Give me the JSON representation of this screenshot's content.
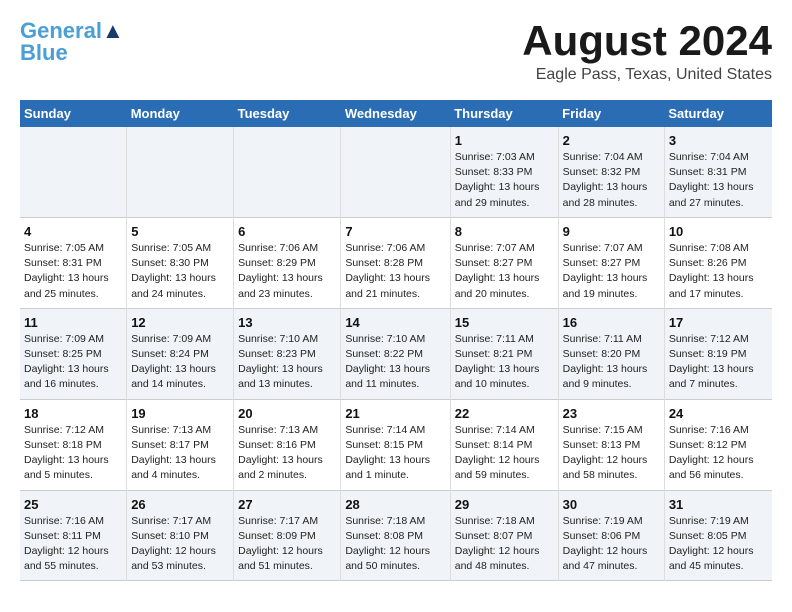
{
  "header": {
    "logo_line1": "General",
    "logo_line2": "Blue",
    "title": "August 2024",
    "subtitle": "Eagle Pass, Texas, United States"
  },
  "weekdays": [
    "Sunday",
    "Monday",
    "Tuesday",
    "Wednesday",
    "Thursday",
    "Friday",
    "Saturday"
  ],
  "weeks": [
    [
      {
        "day": "",
        "info": ""
      },
      {
        "day": "",
        "info": ""
      },
      {
        "day": "",
        "info": ""
      },
      {
        "day": "",
        "info": ""
      },
      {
        "day": "1",
        "info": "Sunrise: 7:03 AM\nSunset: 8:33 PM\nDaylight: 13 hours and 29 minutes."
      },
      {
        "day": "2",
        "info": "Sunrise: 7:04 AM\nSunset: 8:32 PM\nDaylight: 13 hours and 28 minutes."
      },
      {
        "day": "3",
        "info": "Sunrise: 7:04 AM\nSunset: 8:31 PM\nDaylight: 13 hours and 27 minutes."
      }
    ],
    [
      {
        "day": "4",
        "info": "Sunrise: 7:05 AM\nSunset: 8:31 PM\nDaylight: 13 hours and 25 minutes."
      },
      {
        "day": "5",
        "info": "Sunrise: 7:05 AM\nSunset: 8:30 PM\nDaylight: 13 hours and 24 minutes."
      },
      {
        "day": "6",
        "info": "Sunrise: 7:06 AM\nSunset: 8:29 PM\nDaylight: 13 hours and 23 minutes."
      },
      {
        "day": "7",
        "info": "Sunrise: 7:06 AM\nSunset: 8:28 PM\nDaylight: 13 hours and 21 minutes."
      },
      {
        "day": "8",
        "info": "Sunrise: 7:07 AM\nSunset: 8:27 PM\nDaylight: 13 hours and 20 minutes."
      },
      {
        "day": "9",
        "info": "Sunrise: 7:07 AM\nSunset: 8:27 PM\nDaylight: 13 hours and 19 minutes."
      },
      {
        "day": "10",
        "info": "Sunrise: 7:08 AM\nSunset: 8:26 PM\nDaylight: 13 hours and 17 minutes."
      }
    ],
    [
      {
        "day": "11",
        "info": "Sunrise: 7:09 AM\nSunset: 8:25 PM\nDaylight: 13 hours and 16 minutes."
      },
      {
        "day": "12",
        "info": "Sunrise: 7:09 AM\nSunset: 8:24 PM\nDaylight: 13 hours and 14 minutes."
      },
      {
        "day": "13",
        "info": "Sunrise: 7:10 AM\nSunset: 8:23 PM\nDaylight: 13 hours and 13 minutes."
      },
      {
        "day": "14",
        "info": "Sunrise: 7:10 AM\nSunset: 8:22 PM\nDaylight: 13 hours and 11 minutes."
      },
      {
        "day": "15",
        "info": "Sunrise: 7:11 AM\nSunset: 8:21 PM\nDaylight: 13 hours and 10 minutes."
      },
      {
        "day": "16",
        "info": "Sunrise: 7:11 AM\nSunset: 8:20 PM\nDaylight: 13 hours and 9 minutes."
      },
      {
        "day": "17",
        "info": "Sunrise: 7:12 AM\nSunset: 8:19 PM\nDaylight: 13 hours and 7 minutes."
      }
    ],
    [
      {
        "day": "18",
        "info": "Sunrise: 7:12 AM\nSunset: 8:18 PM\nDaylight: 13 hours and 5 minutes."
      },
      {
        "day": "19",
        "info": "Sunrise: 7:13 AM\nSunset: 8:17 PM\nDaylight: 13 hours and 4 minutes."
      },
      {
        "day": "20",
        "info": "Sunrise: 7:13 AM\nSunset: 8:16 PM\nDaylight: 13 hours and 2 minutes."
      },
      {
        "day": "21",
        "info": "Sunrise: 7:14 AM\nSunset: 8:15 PM\nDaylight: 13 hours and 1 minute."
      },
      {
        "day": "22",
        "info": "Sunrise: 7:14 AM\nSunset: 8:14 PM\nDaylight: 12 hours and 59 minutes."
      },
      {
        "day": "23",
        "info": "Sunrise: 7:15 AM\nSunset: 8:13 PM\nDaylight: 12 hours and 58 minutes."
      },
      {
        "day": "24",
        "info": "Sunrise: 7:16 AM\nSunset: 8:12 PM\nDaylight: 12 hours and 56 minutes."
      }
    ],
    [
      {
        "day": "25",
        "info": "Sunrise: 7:16 AM\nSunset: 8:11 PM\nDaylight: 12 hours and 55 minutes."
      },
      {
        "day": "26",
        "info": "Sunrise: 7:17 AM\nSunset: 8:10 PM\nDaylight: 12 hours and 53 minutes."
      },
      {
        "day": "27",
        "info": "Sunrise: 7:17 AM\nSunset: 8:09 PM\nDaylight: 12 hours and 51 minutes."
      },
      {
        "day": "28",
        "info": "Sunrise: 7:18 AM\nSunset: 8:08 PM\nDaylight: 12 hours and 50 minutes."
      },
      {
        "day": "29",
        "info": "Sunrise: 7:18 AM\nSunset: 8:07 PM\nDaylight: 12 hours and 48 minutes."
      },
      {
        "day": "30",
        "info": "Sunrise: 7:19 AM\nSunset: 8:06 PM\nDaylight: 12 hours and 47 minutes."
      },
      {
        "day": "31",
        "info": "Sunrise: 7:19 AM\nSunset: 8:05 PM\nDaylight: 12 hours and 45 minutes."
      }
    ]
  ]
}
